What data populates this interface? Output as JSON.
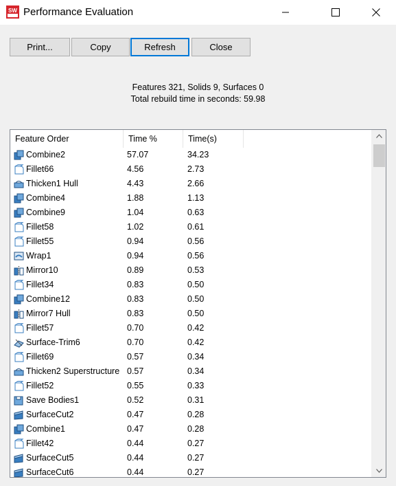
{
  "window": {
    "title": "Performance Evaluation",
    "app_icon_text": "SW"
  },
  "toolbar": {
    "print_label": "Print...",
    "copy_label": "Copy",
    "refresh_label": "Refresh",
    "close_label": "Close"
  },
  "summary": {
    "line1": "Features 321, Solids 9, Surfaces 0",
    "line2": "Total rebuild time in seconds: 59.98"
  },
  "table": {
    "columns": [
      "Feature Order",
      "Time %",
      "Time(s)"
    ],
    "rows": [
      {
        "icon": "combine-icon",
        "name": "Combine2",
        "pct": "57.07",
        "time": "34.23"
      },
      {
        "icon": "fillet-icon",
        "name": "Fillet66",
        "pct": "4.56",
        "time": "2.73"
      },
      {
        "icon": "thicken-icon",
        "name": "Thicken1 Hull",
        "pct": "4.43",
        "time": "2.66"
      },
      {
        "icon": "combine-icon",
        "name": "Combine4",
        "pct": "1.88",
        "time": "1.13"
      },
      {
        "icon": "combine-icon",
        "name": "Combine9",
        "pct": "1.04",
        "time": "0.63"
      },
      {
        "icon": "fillet-icon",
        "name": "Fillet58",
        "pct": "1.02",
        "time": "0.61"
      },
      {
        "icon": "fillet-icon",
        "name": "Fillet55",
        "pct": "0.94",
        "time": "0.56"
      },
      {
        "icon": "wrap-icon",
        "name": "Wrap1",
        "pct": "0.94",
        "time": "0.56"
      },
      {
        "icon": "mirror-icon",
        "name": "Mirror10",
        "pct": "0.89",
        "time": "0.53"
      },
      {
        "icon": "fillet-icon",
        "name": "Fillet34",
        "pct": "0.83",
        "time": "0.50"
      },
      {
        "icon": "combine-icon",
        "name": "Combine12",
        "pct": "0.83",
        "time": "0.50"
      },
      {
        "icon": "mirror-icon",
        "name": "Mirror7 Hull",
        "pct": "0.83",
        "time": "0.50"
      },
      {
        "icon": "fillet-icon",
        "name": "Fillet57",
        "pct": "0.70",
        "time": "0.42"
      },
      {
        "icon": "surface-trim-icon",
        "name": "Surface-Trim6",
        "pct": "0.70",
        "time": "0.42"
      },
      {
        "icon": "fillet-icon",
        "name": "Fillet69",
        "pct": "0.57",
        "time": "0.34"
      },
      {
        "icon": "thicken-icon",
        "name": "Thicken2 Superstructure",
        "pct": "0.57",
        "time": "0.34"
      },
      {
        "icon": "fillet-icon",
        "name": "Fillet52",
        "pct": "0.55",
        "time": "0.33"
      },
      {
        "icon": "save-bodies-icon",
        "name": "Save Bodies1",
        "pct": "0.52",
        "time": "0.31"
      },
      {
        "icon": "surface-cut-icon",
        "name": "SurfaceCut2",
        "pct": "0.47",
        "time": "0.28"
      },
      {
        "icon": "combine-icon",
        "name": "Combine1",
        "pct": "0.47",
        "time": "0.28"
      },
      {
        "icon": "fillet-icon",
        "name": "Fillet42",
        "pct": "0.44",
        "time": "0.27"
      },
      {
        "icon": "surface-cut-icon",
        "name": "SurfaceCut5",
        "pct": "0.44",
        "time": "0.27"
      },
      {
        "icon": "surface-cut-icon",
        "name": "SurfaceCut6",
        "pct": "0.44",
        "time": "0.27"
      }
    ]
  },
  "colors": {
    "accent": "#0078d7",
    "icon_blue": "#3a7fc1",
    "app_red": "#d6252c"
  }
}
